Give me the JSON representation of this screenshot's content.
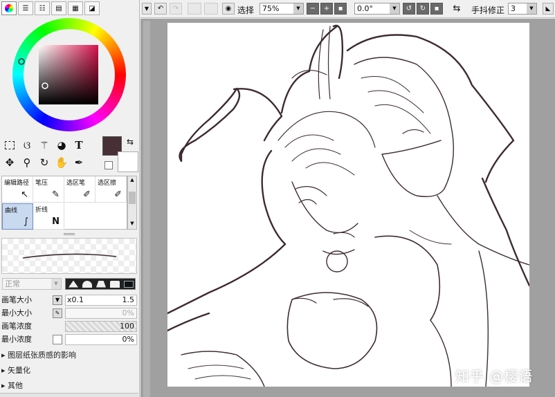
{
  "left_panel": {
    "color_tabs": [
      "color-wheel",
      "rgb-sliders",
      "hsv-sliders",
      "palette",
      "color-set",
      "scratchpad"
    ],
    "main_color": "#482f35",
    "sub_color": "#ffffff",
    "brushes": [
      {
        "label": "编辑路径",
        "icon": "edit-path-icon",
        "glyph": "↖"
      },
      {
        "label": "笔压",
        "icon": "pressure-icon",
        "glyph": "✎"
      },
      {
        "label": "选区笔",
        "icon": "selection-pen-icon",
        "glyph": "✐"
      },
      {
        "label": "选区擦",
        "icon": "selection-eraser-icon",
        "glyph": "✐"
      },
      {
        "label": "曲线",
        "icon": "curve-icon",
        "glyph": "∫",
        "selected": true
      },
      {
        "label": "折线",
        "icon": "polyline-icon",
        "glyph": "N"
      }
    ],
    "blend_mode": "正常",
    "props": {
      "size_label": "画笔大小",
      "size_prefix": "x0.1",
      "size_value": "1.5",
      "min_size_label": "最小大小",
      "min_size_value": "0%",
      "density_label": "画笔浓度",
      "density_value": "100",
      "min_density_label": "最小浓度",
      "min_density_value": "0%"
    },
    "sections": [
      "图层纸张质感的影响",
      "矢量化",
      "其他"
    ]
  },
  "toolbar": {
    "select_label": "选择",
    "zoom": "75%",
    "angle": "0.0°",
    "stabilizer_label": "手抖修正",
    "stabilizer_value": "3"
  },
  "watermark": "知乎 @樱语",
  "colors": {
    "canvas_bg": "#a0a0a0",
    "paper": "#ffffff",
    "line": "#3d2b30"
  }
}
